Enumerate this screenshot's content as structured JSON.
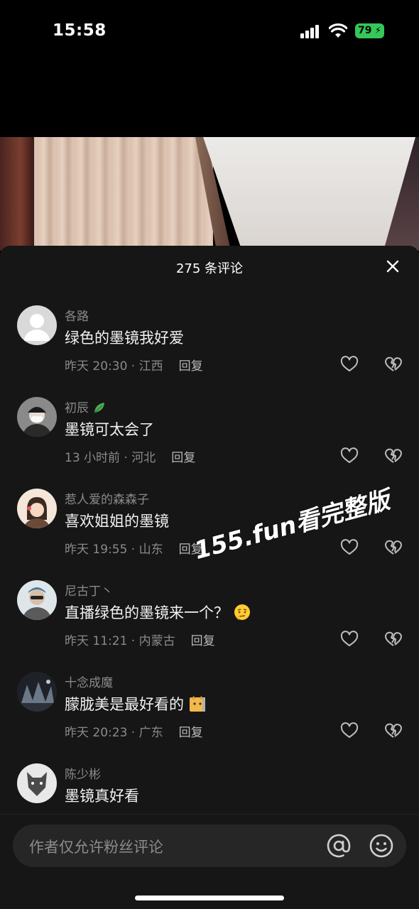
{
  "status_bar": {
    "time": "15:58",
    "battery": "79"
  },
  "sheet": {
    "title": "275 条评论",
    "reply_label": "回复"
  },
  "watermark": "155.fun看完整版",
  "comments": [
    {
      "user": "各路",
      "text": "绿色的墨镜我好爱",
      "meta": "昨天 20:30 · 江西"
    },
    {
      "user": "初辰",
      "text": "墨镜可太会了",
      "meta": "13 小时前 · 河北"
    },
    {
      "user": "惹人爱的森森子",
      "text": "喜欢姐姐的墨镜",
      "meta": "昨天 19:55 · 山东"
    },
    {
      "user": "尼古丁丶",
      "text": "直播绿色的墨镜来一个？",
      "meta": "昨天 11:21 · 内蒙古"
    },
    {
      "user": "十念成魔",
      "text": "朦胧美是最好看的",
      "meta": "昨天 20:23 · 广东"
    },
    {
      "user": "陈少彬",
      "text": "墨镜真好看",
      "meta": ""
    }
  ],
  "input": {
    "placeholder": "作者仅允许粉丝评论"
  },
  "icons": {
    "close": "close-icon",
    "like": "heart-icon",
    "dislike": "broken-heart-icon",
    "at": "at-icon",
    "emoji": "smile-icon"
  }
}
